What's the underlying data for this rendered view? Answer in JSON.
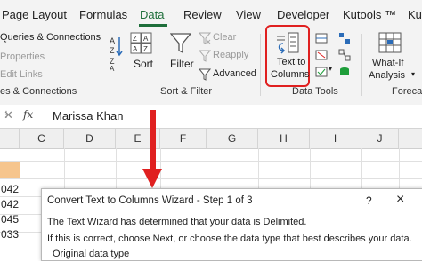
{
  "tabs": [
    {
      "label": "Page Layout",
      "active": false
    },
    {
      "label": "Formulas",
      "active": false
    },
    {
      "label": "Data",
      "active": true
    },
    {
      "label": "Review",
      "active": false
    },
    {
      "label": "View",
      "active": false
    },
    {
      "label": "Developer",
      "active": false
    },
    {
      "label": "Kutools ™",
      "active": false
    },
    {
      "label": "Ku",
      "active": false
    }
  ],
  "ribbon": {
    "queries_connections": {
      "items": [
        "Queries & Connections",
        "Properties",
        "Edit Links"
      ],
      "group_label": "es & Connections"
    },
    "sort_filter": {
      "sort_label": "Sort",
      "filter_label": "Filter",
      "clear_label": "Clear",
      "reapply_label": "Reapply",
      "advanced_label": "Advanced",
      "group_label": "Sort & Filter"
    },
    "data_tools": {
      "text_to_columns_line1": "Text to",
      "text_to_columns_line2": "Columns",
      "group_label": "Data Tools"
    },
    "forecast": {
      "whatif_line1": "What-If",
      "whatif_line2": "Analysis",
      "group_label": "Foreca"
    },
    "accent_color": "#1e6e3a",
    "highlight_color": "#e02020"
  },
  "formula_bar": {
    "fx_label": "fx",
    "value": "Marissa Khan"
  },
  "grid": {
    "columns": [
      "C",
      "D",
      "E",
      "F",
      "G",
      "H",
      "I",
      "J"
    ],
    "row_values": [
      "042",
      "042",
      "045",
      "033"
    ],
    "selected_fill": "#f6c58d"
  },
  "dialog": {
    "title": "Convert Text to Columns Wizard - Step 1 of 3",
    "help_button": "?",
    "close_button": "×",
    "line1": "The Text Wizard has determined that your data is Delimited.",
    "line2": "If this is correct, choose Next, or choose the data type that best describes your data.",
    "section_label": "Original data type"
  }
}
